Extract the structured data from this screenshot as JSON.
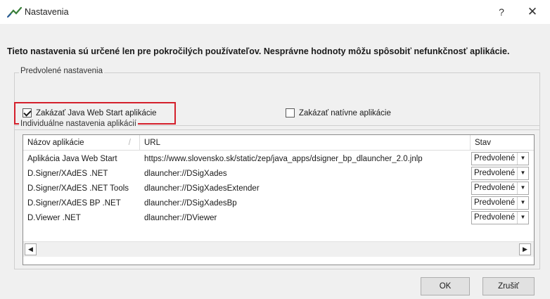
{
  "window": {
    "title": "Nastavenia",
    "help_label": "?",
    "close_label": "✕"
  },
  "warning": "Tieto nastavenia sú určené len pre pokročilých používateľov. Nesprávne hodnoty môžu spôsobiť nefunkčnosť aplikácie.",
  "default_settings": {
    "group_label": "Predvolené nastavenia",
    "disable_java": {
      "label": "Zakázať Java Web Start aplikácie",
      "checked": true
    },
    "disable_native": {
      "label": "Zakázať natívne aplikácie",
      "checked": false
    }
  },
  "individual": {
    "group_label": "Individuálne nastavenia aplikácií",
    "columns": [
      "Názov aplikácie",
      "URL",
      "Stav"
    ],
    "rows": [
      {
        "name": "Aplikácia Java Web Start",
        "url": "https://www.slovensko.sk/static/zep/java_apps/dsigner_bp_dlauncher_2.0.jnlp",
        "state": "Predvolené"
      },
      {
        "name": "D.Signer/XAdES .NET",
        "url": "dlauncher://DSigXades",
        "state": "Predvolené"
      },
      {
        "name": "D.Signer/XAdES .NET Tools",
        "url": "dlauncher://DSigXadesExtender",
        "state": "Predvolené"
      },
      {
        "name": "D.Signer/XAdES BP .NET",
        "url": "dlauncher://DSigXadesBp",
        "state": "Predvolené"
      },
      {
        "name": "D.Viewer .NET",
        "url": "dlauncher://DViewer",
        "state": "Predvolené"
      }
    ]
  },
  "buttons": {
    "ok": "OK",
    "cancel": "Zrušiť"
  },
  "colors": {
    "highlight": "#d4202c",
    "background": "#f0f0f0",
    "titlebar": "#ffffff"
  }
}
